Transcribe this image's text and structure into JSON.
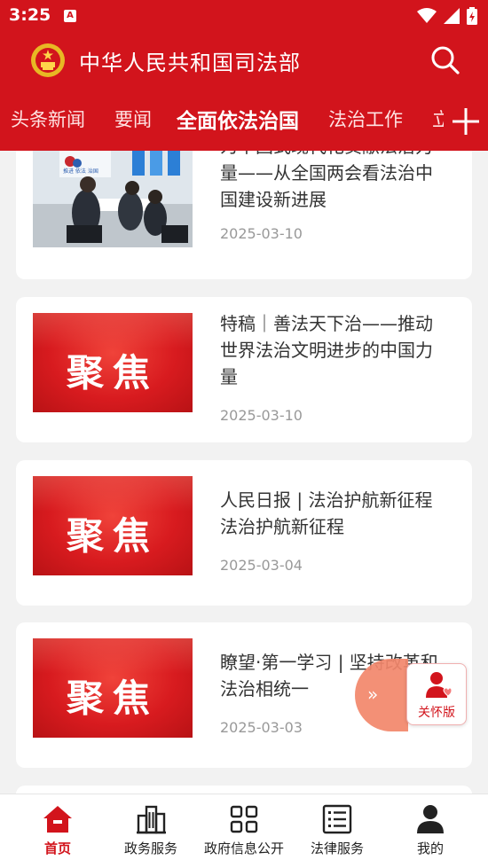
{
  "status_bar": {
    "time": "3:25",
    "notification_icon": "a-letter-icon",
    "icons": [
      "wifi-icon",
      "signal-icon",
      "battery-charging-icon"
    ]
  },
  "app": {
    "title": "中华人民共和国司法部",
    "search_icon": "search-icon",
    "emblem_icon": "national-emblem-icon"
  },
  "tabs": [
    {
      "label": "头条新闻",
      "active": false
    },
    {
      "label": "要闻",
      "active": false
    },
    {
      "label": "全面依法治国",
      "active": true
    },
    {
      "label": "法治工作",
      "active": false
    },
    {
      "label": "立",
      "active": false
    }
  ],
  "tab_add_icon": "plus-icon",
  "articles": [
    {
      "title": "为中国式现代化贡献法治力量——从全国两会看法治中国建设新进展",
      "date": "2025-03-10",
      "thumb": "photo"
    },
    {
      "title": "特稿｜善法天下治——推动世界法治文明进步的中国力量",
      "date": "2025-03-10",
      "thumb": "focus"
    },
    {
      "title": "人民日报 | 法治护航新征程法治护航新征程",
      "date": "2025-03-04",
      "thumb": "focus"
    },
    {
      "title": "瞭望·第一学习 | 坚持改革和法治相统一",
      "date": "2025-03-03",
      "thumb": "focus"
    }
  ],
  "focus_thumb_text": "聚焦",
  "photo_thumb_sign": "推进 依法 治国",
  "float_arrow": "»",
  "care_mode": {
    "label": "关怀版",
    "icon": "elder-care-icon"
  },
  "bottom_nav": [
    {
      "label": "首页",
      "icon": "home-icon",
      "active": true
    },
    {
      "label": "政务服务",
      "icon": "building-icon",
      "active": false
    },
    {
      "label": "政府信息公开",
      "icon": "grid-icon",
      "active": false
    },
    {
      "label": "法律服务",
      "icon": "list-icon",
      "active": false
    },
    {
      "label": "我的",
      "icon": "person-icon",
      "active": false
    }
  ],
  "colors": {
    "brand_red": "#d2141c",
    "date_gray": "#999999",
    "float_orange": "#f2876b"
  }
}
